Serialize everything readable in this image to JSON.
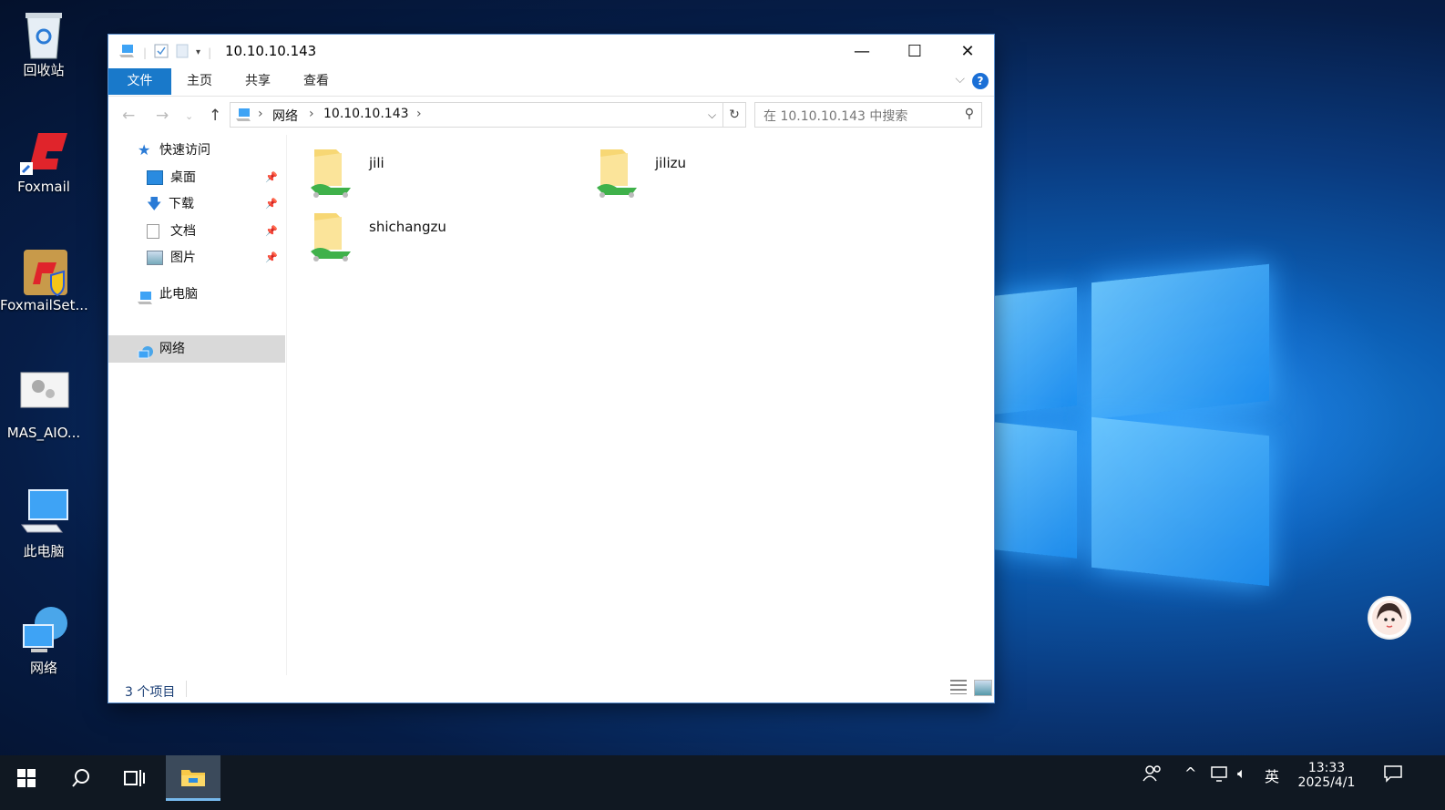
{
  "desktop": {
    "icons": [
      {
        "label": "回收站",
        "icon": "recycle-bin-icon"
      },
      {
        "label": "Foxmail",
        "icon": "foxmail-icon"
      },
      {
        "label": "FoxmailSet...",
        "icon": "foxmail-setup-icon"
      },
      {
        "label": "MAS_AIO...",
        "icon": "settings-file-icon"
      },
      {
        "label": "此电脑",
        "icon": "this-pc-icon"
      },
      {
        "label": "网络",
        "icon": "network-icon"
      }
    ]
  },
  "window": {
    "title": "10.10.10.143",
    "controls": {
      "minimize": "—",
      "maximize": "☐",
      "close": "✕"
    },
    "ribbon_tabs": [
      "文件",
      "主页",
      "共享",
      "查看"
    ],
    "help": "?",
    "address": {
      "crumbs": [
        "网络",
        "10.10.10.143"
      ]
    },
    "search": {
      "placeholder": "在 10.10.10.143 中搜索"
    },
    "sidebar": {
      "quick_access": "快速访问",
      "items": [
        "桌面",
        "下载",
        "文档",
        "图片"
      ],
      "this_pc": "此电脑",
      "network": "网络"
    },
    "folders": [
      "jili",
      "jilizu",
      "shichangzu"
    ],
    "status": "3 个项目"
  },
  "taskbar": {
    "ime": "英",
    "time": "13:33",
    "date": "2025/4/1"
  },
  "colors": {
    "accent": "#1979ca",
    "taskbar": "#101822"
  }
}
